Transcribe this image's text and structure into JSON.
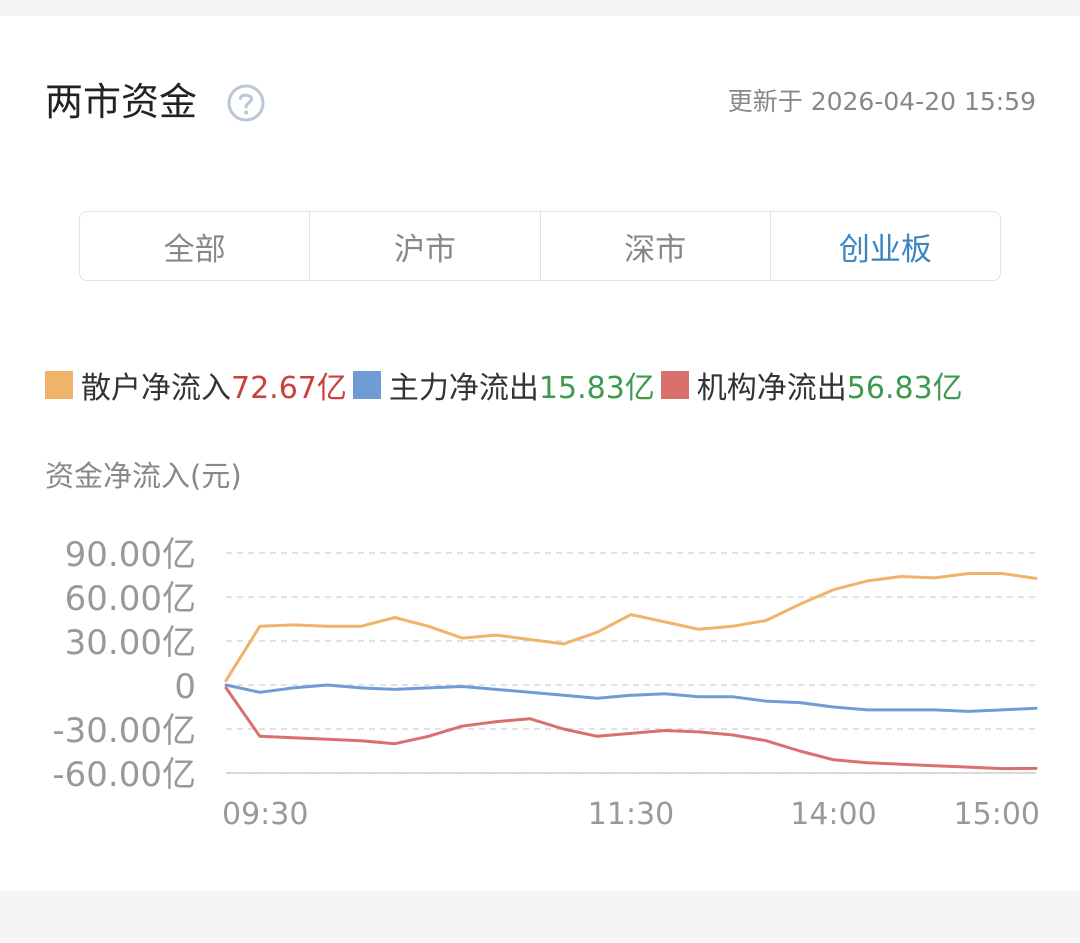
{
  "header": {
    "title": "两市资金",
    "help_icon": "question-circle-icon",
    "updated": "更新于 2026-04-20 15:59"
  },
  "tabs": [
    {
      "label": "全部",
      "active": false
    },
    {
      "label": "沪市",
      "active": false
    },
    {
      "label": "深市",
      "active": false
    },
    {
      "label": "创业板",
      "active": true
    }
  ],
  "legend": [
    {
      "label": "散户净流入",
      "value": "72.67亿",
      "color": "#f0b36a",
      "value_color": "#c9403c"
    },
    {
      "label": "主力净流出",
      "value": "15.83亿",
      "color": "#6f9cd4",
      "value_color": "#3e9a4e"
    },
    {
      "label": "机构净流出",
      "value": "56.83亿",
      "color": "#d9706c",
      "value_color": "#3e9a4e"
    }
  ],
  "chart_data": {
    "type": "line",
    "ylabel": "资金净流入(元)",
    "ylim": [
      -60,
      90
    ],
    "y_ticks": [
      {
        "value": 90,
        "label": "90.00亿"
      },
      {
        "value": 60,
        "label": "60.00亿"
      },
      {
        "value": 30,
        "label": "30.00亿"
      },
      {
        "value": 0,
        "label": "0"
      },
      {
        "value": -30,
        "label": "-30.00亿"
      },
      {
        "value": -60,
        "label": "-60.00亿"
      }
    ],
    "x_ticks": [
      "09:30",
      "11:30",
      "14:00",
      "15:00"
    ],
    "x": [
      "09:30",
      "09:40",
      "09:50",
      "10:00",
      "10:10",
      "10:20",
      "10:30",
      "10:40",
      "10:50",
      "11:00",
      "11:10",
      "11:20",
      "11:30",
      "13:10",
      "13:20",
      "13:30",
      "13:40",
      "13:50",
      "14:00",
      "14:10",
      "14:20",
      "14:30",
      "14:40",
      "14:50",
      "15:00"
    ],
    "x_tick_index": [
      0,
      12,
      18,
      24
    ],
    "grid": true,
    "series": [
      {
        "name": "散户净流入",
        "color": "#f0b36a",
        "values": [
          3,
          40,
          41,
          40,
          40,
          46,
          40,
          32,
          34,
          31,
          28,
          36,
          48,
          43,
          38,
          40,
          44,
          55,
          65,
          71,
          74,
          73,
          76,
          76,
          72.67
        ]
      },
      {
        "name": "主力净流出",
        "color": "#6f9cd4",
        "values": [
          0,
          -5,
          -2,
          0,
          -2,
          -3,
          -2,
          -1,
          -3,
          -5,
          -7,
          -9,
          -7,
          -6,
          -8,
          -8,
          -11,
          -12,
          -15,
          -17,
          -17,
          -17,
          -18,
          -17,
          -15.83
        ]
      },
      {
        "name": "机构净流出",
        "color": "#d9706c",
        "values": [
          -2,
          -35,
          -36,
          -37,
          -38,
          -40,
          -35,
          -28,
          -25,
          -23,
          -30,
          -35,
          -33,
          -31,
          -32,
          -34,
          -38,
          -45,
          -51,
          -53,
          -54,
          -55,
          -56,
          -57,
          -56.83
        ]
      }
    ]
  }
}
